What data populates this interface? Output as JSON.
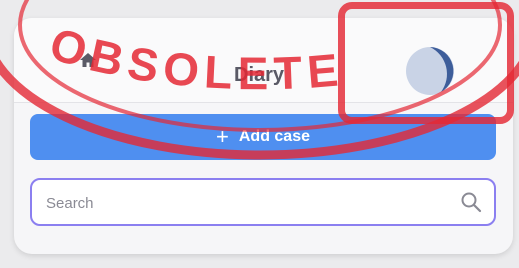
{
  "header": {
    "title": "Diary",
    "home_icon": "home-icon",
    "avatar_icon": "avatar"
  },
  "actions": {
    "add_case_label": "Add case",
    "add_icon": "plus-icon"
  },
  "search": {
    "placeholder": "Search",
    "value": "",
    "icon": "search-icon"
  },
  "watermark": {
    "text": "OBSOLETE",
    "color": "#e42834"
  },
  "colors": {
    "accent": "#4f8ff0",
    "search_border": "#8b7ff0",
    "avatar": "#3d5d9a"
  }
}
